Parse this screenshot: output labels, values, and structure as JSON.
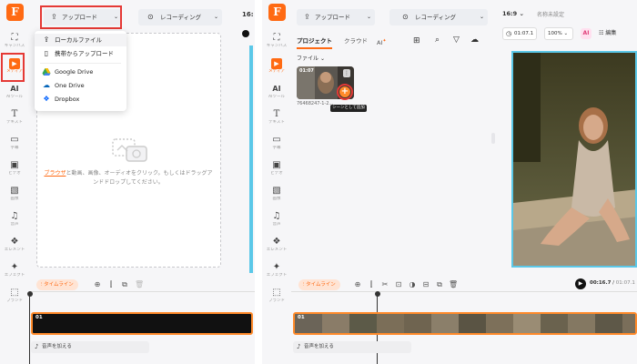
{
  "left": {
    "logo_letter": "F",
    "rail": [
      {
        "label": "キャンバス",
        "icon": "expand-icon"
      },
      {
        "label": "メディア",
        "icon": "media-folder-icon"
      },
      {
        "label": "AIツール",
        "icon": "ai-icon"
      },
      {
        "label": "テキスト",
        "icon": "text-icon"
      },
      {
        "label": "字幕",
        "icon": "subtitle-icon"
      },
      {
        "label": "ビデオ",
        "icon": "video-icon"
      },
      {
        "label": "画像",
        "icon": "image-icon"
      },
      {
        "label": "音声",
        "icon": "music-icon"
      },
      {
        "label": "エレメント",
        "icon": "element-icon"
      },
      {
        "label": "エフェクト",
        "icon": "effect-icon"
      },
      {
        "label": "ブランド",
        "icon": "brand-icon"
      }
    ],
    "upload_label": "アップロード",
    "recording_label": "レコーディング",
    "aspect_label": "16:",
    "dropdown": [
      {
        "label": "ローカルファイル",
        "icon": "upload-icon"
      },
      {
        "label": "携帯からアップロード",
        "icon": "phone-icon"
      },
      {
        "label": "Google Drive",
        "icon": "google-drive-icon"
      },
      {
        "label": "One Drive",
        "icon": "onedrive-icon"
      },
      {
        "label": "Dropbox",
        "icon": "dropbox-icon"
      }
    ],
    "hint_link": "ブラウザ",
    "hint_rest": "と動画、画像、オーディオをクリック。もしくはドラッグアンドドロップしてください。",
    "timeline_label": "タイムライン",
    "track_label": "01",
    "audio_label": "音声を加える"
  },
  "right": {
    "logo_letter": "F",
    "rail": [
      {
        "label": "キャンバス",
        "icon": "expand-icon"
      },
      {
        "label": "メディア",
        "icon": "media-folder-icon"
      },
      {
        "label": "AIツール",
        "icon": "ai-icon"
      },
      {
        "label": "テキスト",
        "icon": "text-icon"
      },
      {
        "label": "字幕",
        "icon": "subtitle-icon"
      },
      {
        "label": "ビデオ",
        "icon": "video-icon"
      },
      {
        "label": "画像",
        "icon": "image-icon"
      },
      {
        "label": "音声",
        "icon": "music-icon"
      },
      {
        "label": "エレメント",
        "icon": "element-icon"
      },
      {
        "label": "エフェクト",
        "icon": "effect-icon"
      },
      {
        "label": "ブランド",
        "icon": "brand-icon"
      }
    ],
    "upload_label": "アップロード",
    "recording_label": "レコーディング",
    "tabs": [
      "プロジェクト",
      "クラウド",
      "AI"
    ],
    "filter_label": "ファイル",
    "thumb_duration": "01:07",
    "thumb_name": "76468247-1-2...",
    "tooltip": "シーンとして追加",
    "aspect": "16:9",
    "project_name": "名称未設定",
    "duration_display": "01:07.1",
    "zoom": "100%",
    "edit_label": "編集",
    "timeline_label": "タイムライン",
    "current_time": "00:16.7",
    "total_time": "01:07.1",
    "track_label": "01",
    "audio_label": "音声を加える"
  },
  "colors": {
    "accent": "#ff6a13",
    "highlight": "#e53935",
    "selection": "#5bc8e8"
  }
}
